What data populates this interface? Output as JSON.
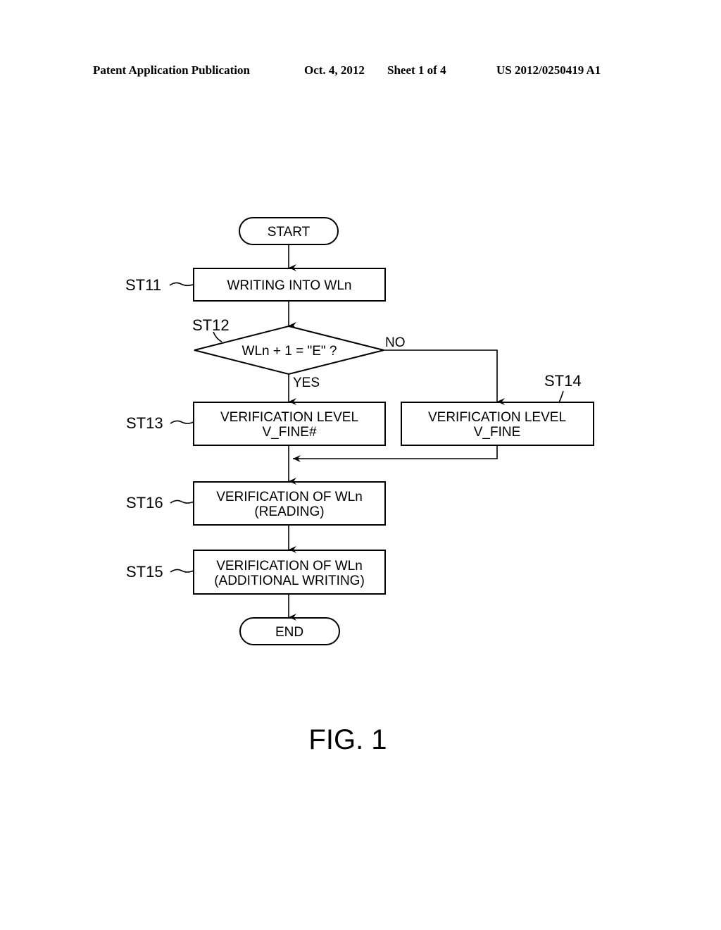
{
  "header": {
    "publication": "Patent Application Publication",
    "date": "Oct. 4, 2012",
    "sheet": "Sheet 1 of 4",
    "number": "US 2012/0250419 A1"
  },
  "flowchart": {
    "start": "START",
    "end": "END",
    "steps": {
      "st11": {
        "label": "ST11",
        "lines": [
          "WRITING INTO WLn"
        ]
      },
      "st12": {
        "label": "ST12",
        "lines": [
          "WLn + 1 = \"E\" ?"
        ],
        "yes": "YES",
        "no": "NO"
      },
      "st13": {
        "label": "ST13",
        "lines": [
          "VERIFICATION LEVEL",
          "V_FINE#"
        ]
      },
      "st14": {
        "label": "ST14",
        "lines": [
          "VERIFICATION LEVEL",
          "V_FINE"
        ]
      },
      "st16": {
        "label": "ST16",
        "lines": [
          "VERIFICATION OF WLn",
          "(READING)"
        ]
      },
      "st15": {
        "label": "ST15",
        "lines": [
          "VERIFICATION OF WLn",
          "(ADDITIONAL WRITING)"
        ]
      }
    }
  },
  "figure_caption": "FIG. 1"
}
